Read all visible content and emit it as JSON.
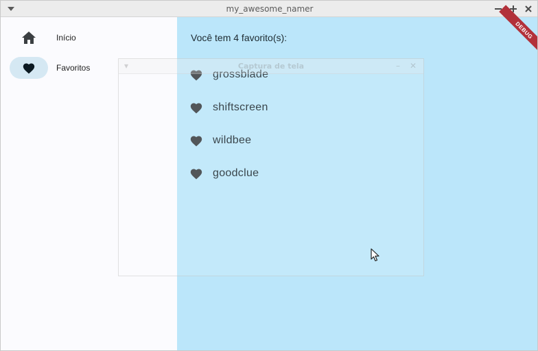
{
  "window": {
    "title": "my_awesome_namer"
  },
  "sidebar": {
    "items": [
      {
        "label": "Início",
        "icon": "home-icon",
        "selected": false
      },
      {
        "label": "Favoritos",
        "icon": "heart-icon",
        "selected": true
      }
    ]
  },
  "main": {
    "count_text": "Você tem 4 favorito(s):",
    "favorites": [
      {
        "name": "grossblade"
      },
      {
        "name": "shiftscreen"
      },
      {
        "name": "wildbee"
      },
      {
        "name": "goodclue"
      }
    ]
  },
  "overlay_window": {
    "title": "Captura de tela"
  },
  "debug_banner": "DEBUG",
  "colors": {
    "main_background": "#bbe6fa",
    "sidebar_background": "#fbfbfe",
    "selected_pill": "#d5e8f3",
    "heart_icon": "#3b3f42",
    "debug_ribbon": "#b2313a"
  }
}
